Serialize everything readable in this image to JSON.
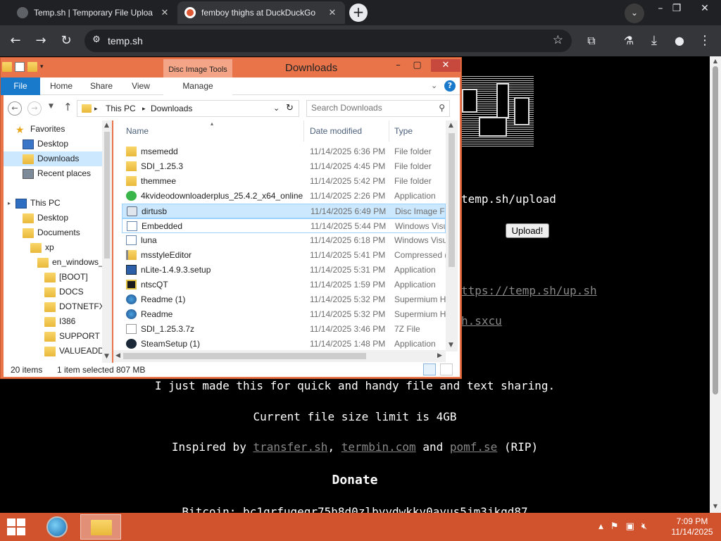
{
  "browser": {
    "tabs": [
      {
        "title": "Temp.sh | Temporary File Uploa"
      },
      {
        "title": "femboy thighs at DuckDuckGo"
      }
    ],
    "new_tab_glyph": "+",
    "address": "temp.sh",
    "colors": {
      "tabbar": "#202124",
      "toolbar": "#35363a"
    }
  },
  "webpage": {
    "upload_url": "temp.sh/upload",
    "upload_button": "Upload!",
    "upsh_link": "ttps://temp.sh/up.sh",
    "sxcu_link": "h.sxcu",
    "intro": "I just made this for quick and handy file and text sharing.",
    "limit": "Current file size limit is 4GB",
    "inspired": {
      "prefix": "Inspired by",
      "link1": "transfer.sh",
      "comma": ",",
      "link2": "termbin.com",
      "and": "and",
      "link3": "pomf.se",
      "suffix": "(RIP)"
    },
    "donate_heading": "Donate",
    "bitcoin_partial": "Bitcoin: bc1qrfugegr75h8d0zlbyydwkkv0ayus5jm3jkqd87"
  },
  "explorer": {
    "title": "Downloads",
    "tools_tab": "Disc Image Tools",
    "ribbon_tabs": [
      "File",
      "Home",
      "Share",
      "View",
      "Manage"
    ],
    "breadcrumb": [
      "This PC",
      "Downloads"
    ],
    "search_placeholder": "Search Downloads",
    "columns": {
      "name": "Name",
      "date": "Date modified",
      "type": "Type"
    },
    "nav": {
      "favorites": "Favorites",
      "desktop": "Desktop",
      "downloads": "Downloads",
      "recent": "Recent places",
      "this_pc": "This PC",
      "pc_desktop": "Desktop",
      "documents": "Documents",
      "xp": "xp",
      "en_windows": "en_windows_",
      "boot": "[BOOT]",
      "docs": "DOCS",
      "dotnetfx": "DOTNETFX",
      "i386": "I386",
      "support": "SUPPORT",
      "valueadd": "VALUEADD"
    },
    "files": [
      {
        "name": "msemedd",
        "date": "11/14/2025 6:36 PM",
        "type": "File folder",
        "icon": "folder"
      },
      {
        "name": "SDI_1.25.3",
        "date": "11/14/2025 4:45 PM",
        "type": "File folder",
        "icon": "folder"
      },
      {
        "name": "themmee",
        "date": "11/14/2025 5:42 PM",
        "type": "File folder",
        "icon": "folder"
      },
      {
        "name": "4kvideodownloaderplus_25.4.2_x64_online",
        "date": "11/14/2025 2:26 PM",
        "type": "Application",
        "icon": "app-green"
      },
      {
        "name": "dirtusb",
        "date": "11/14/2025 6:49 PM",
        "type": "Disc Image Fil",
        "icon": "disc"
      },
      {
        "name": "Embedded",
        "date": "11/14/2025 5:44 PM",
        "type": "Windows Visu",
        "icon": "doc"
      },
      {
        "name": "luna",
        "date": "11/14/2025 6:18 PM",
        "type": "Windows Visu",
        "icon": "doc"
      },
      {
        "name": "msstyleEditor",
        "date": "11/14/2025 5:41 PM",
        "type": "Compressed (",
        "icon": "zip"
      },
      {
        "name": "nLite-1.4.9.3.setup",
        "date": "11/14/2025 5:31 PM",
        "type": "Application",
        "icon": "setup"
      },
      {
        "name": "ntscQT",
        "date": "11/14/2025 1:59 PM",
        "type": "Application",
        "icon": "app-dark"
      },
      {
        "name": "Readme (1)",
        "date": "11/14/2025 5:32 PM",
        "type": "Supermium H",
        "icon": "browser"
      },
      {
        "name": "Readme",
        "date": "11/14/2025 5:32 PM",
        "type": "Supermium H",
        "icon": "browser"
      },
      {
        "name": "SDI_1.25.3.7z",
        "date": "11/14/2025 3:46 PM",
        "type": "7Z File",
        "icon": "file"
      },
      {
        "name": "SteamSetup (1)",
        "date": "11/14/2025 1:48 PM",
        "type": "Application",
        "icon": "steam"
      }
    ],
    "status": {
      "count": "20 items",
      "selected": "1 item selected",
      "size": "807 MB"
    },
    "colors": {
      "frame": "#e9744a",
      "file_tab": "#1979ca",
      "selection": "#cce8ff"
    }
  },
  "taskbar": {
    "time": "7:09 PM",
    "date": "11/14/2025",
    "color": "#d1532e"
  }
}
